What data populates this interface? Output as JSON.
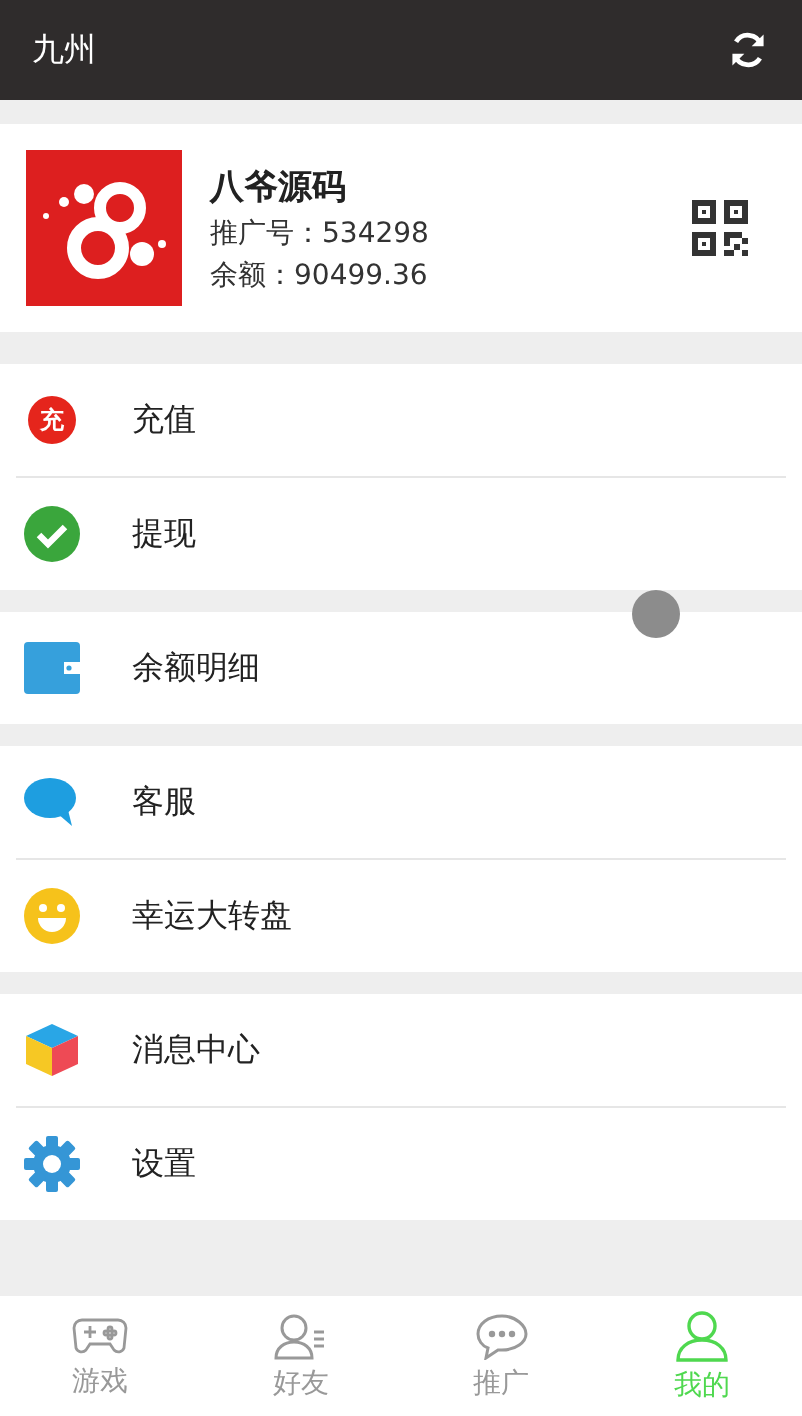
{
  "header": {
    "title": "九州"
  },
  "profile": {
    "name": "八爷源码",
    "referral_label": "推广号：",
    "referral": "534298",
    "balance_label": "余额：",
    "balance": "90499.36"
  },
  "menu_groups": [
    [
      {
        "kind": "recharge",
        "icon_text": "充",
        "label": "充值"
      },
      {
        "kind": "withdraw",
        "label": "提现"
      }
    ],
    [
      {
        "kind": "wallet",
        "label": "余额明细"
      }
    ],
    [
      {
        "kind": "chat",
        "label": "客服"
      },
      {
        "kind": "smile",
        "label": "幸运大转盘"
      }
    ],
    [
      {
        "kind": "cube",
        "label": "消息中心"
      },
      {
        "kind": "gear",
        "label": "设置"
      }
    ]
  ],
  "tabs": [
    {
      "kind": "game",
      "label": "游戏",
      "selected": false
    },
    {
      "kind": "friends",
      "label": "好友",
      "selected": false
    },
    {
      "kind": "promo",
      "label": "推广",
      "selected": false
    },
    {
      "kind": "me",
      "label": "我的",
      "selected": true
    }
  ]
}
